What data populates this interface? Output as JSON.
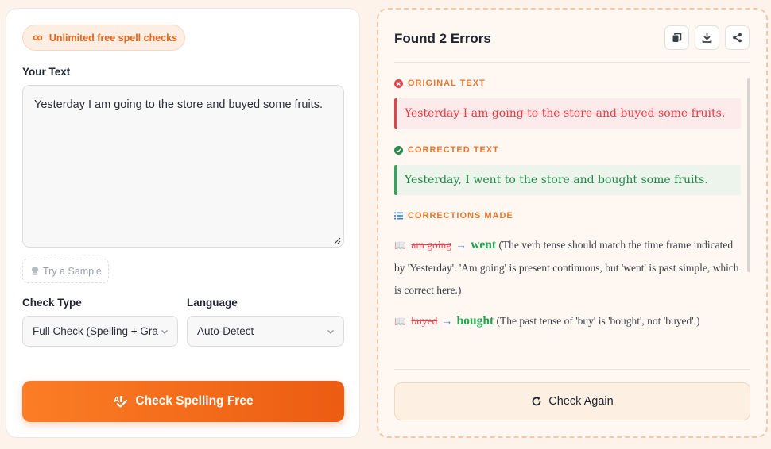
{
  "colors": {
    "accent": "#ec5c12",
    "error": "#e0454f",
    "success": "#22a550",
    "link_arrow": "#2f7fd8"
  },
  "badge": {
    "icon": "infinity-icon",
    "label": "Unlimited free spell checks"
  },
  "input": {
    "label": "Your Text",
    "value": "Yesterday I am going to the store and buyed some fruits."
  },
  "sample": {
    "icon": "lightbulb-icon",
    "label": "Try a Sample"
  },
  "check_type": {
    "label": "Check Type",
    "selected": "Full Check (Spelling + Grammar)"
  },
  "language": {
    "label": "Language",
    "selected": "Auto-Detect"
  },
  "primary_button": {
    "icon": "spellcheck-icon",
    "label": "Check Spelling Free"
  },
  "results": {
    "title": "Found 2 Errors",
    "actions": [
      "copy-icon",
      "download-icon",
      "share-icon"
    ],
    "original_heading": "ORIGINAL TEXT",
    "original_text": "Yesterday I am going to the store and buyed some fruits.",
    "corrected_heading": "CORRECTED TEXT",
    "corrected_text": "Yesterday, I went to the store and bought some fruits.",
    "corrections_heading": "CORRECTIONS MADE",
    "corrections": [
      {
        "wrong": "am going",
        "arrow": "→",
        "right": "went",
        "explanation": "(The verb tense should match the time frame indicated by 'Yesterday'. 'Am going' is present continuous, but 'went' is past simple, which is correct here.)"
      },
      {
        "wrong": "buyed",
        "arrow": "→",
        "right": "bought",
        "explanation": "(The past tense of 'buy' is 'bought', not 'buyed'.)"
      }
    ],
    "again_button": {
      "icon": "refresh-icon",
      "label": "Check Again"
    }
  }
}
